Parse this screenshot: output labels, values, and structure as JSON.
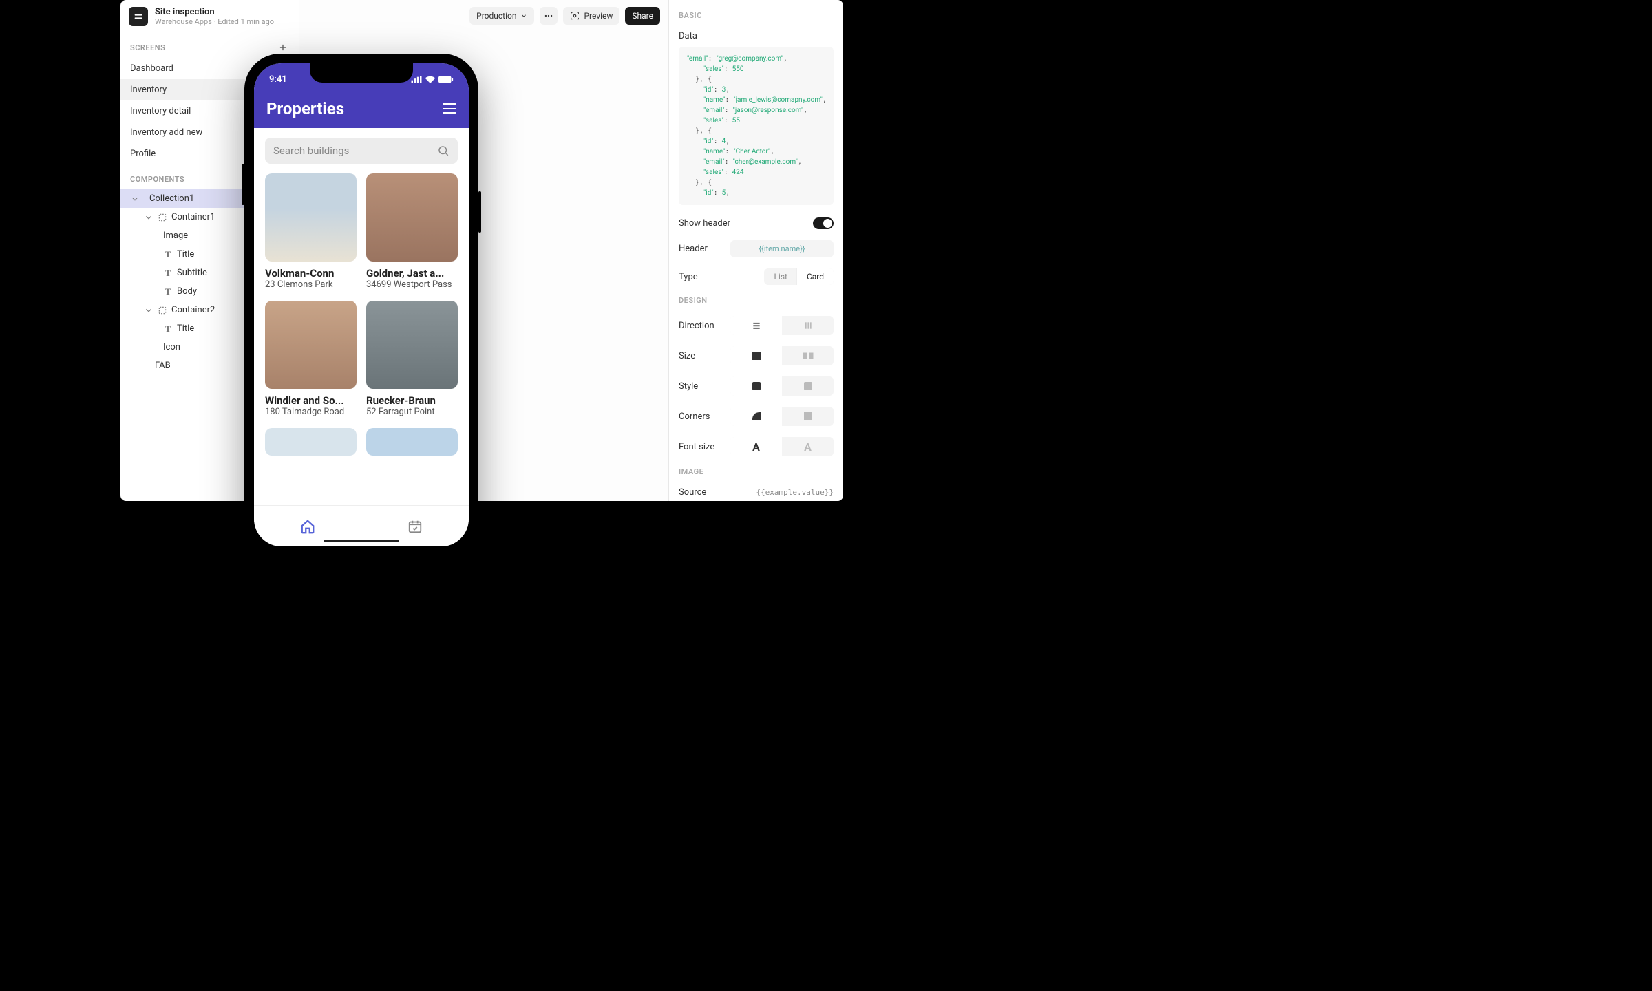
{
  "app": {
    "title": "Site inspection",
    "subtitle": "Warehouse Apps · Edited 1 min ago"
  },
  "topbar": {
    "env": "Production",
    "preview": "Preview",
    "share": "Share"
  },
  "sections": {
    "screens": "SCREENS",
    "components": "COMPONENTS"
  },
  "screens": [
    "Dashboard",
    "Inventory",
    "Inventory detail",
    "Inventory add new",
    "Profile"
  ],
  "selected_screen": "Inventory",
  "components": {
    "collection": "Collection1",
    "container1": "Container1",
    "image": "Image",
    "title": "Title",
    "subtitle": "Subtitle",
    "body": "Body",
    "container2": "Container2",
    "title2": "Title",
    "icon": "Icon",
    "fab": "FAB"
  },
  "right": {
    "basic": "BASIC",
    "data": "Data",
    "show_header": "Show header",
    "header": "Header",
    "header_value": "{{item.name}}",
    "type": "Type",
    "type_list": "List",
    "type_card": "Card",
    "design": "DESIGN",
    "direction": "Direction",
    "size": "Size",
    "style": "Style",
    "corners": "Corners",
    "font_size": "Font size",
    "image": "IMAGE",
    "source": "Source",
    "source_value": "{{example.value}}"
  },
  "code": {
    "line1": "    \"email\": \"greg@company.com\",",
    "line2": "    \"sales\": 550",
    "line3": "  }, {",
    "line4": "    \"id\": 3,",
    "line5": "    \"name\": \"jamie_lewis@comapny.com\",",
    "line6": "    \"email\": \"jason@response.com\",",
    "line7": "    \"sales\": 55",
    "line8": "  }, {",
    "line9": "    \"id\": 4,",
    "line10": "    \"name\": \"Cher Actor\",",
    "line11": "    \"email\": \"cher@example.com\",",
    "line12": "    \"sales\": 424",
    "line13": "  }, {",
    "line14": "    \"id\": 5,"
  },
  "phone": {
    "time": "9:41",
    "title": "Properties",
    "search_placeholder": "Search buildings",
    "cards": [
      {
        "title": "Volkman-Conn",
        "sub": "23 Clemons Park"
      },
      {
        "title": "Goldner, Jast a...",
        "sub": "34699 Westport Pass"
      },
      {
        "title": "Windler and So...",
        "sub": "180 Talmadge Road"
      },
      {
        "title": "Ruecker-Braun",
        "sub": "52 Farragut Point"
      }
    ]
  }
}
